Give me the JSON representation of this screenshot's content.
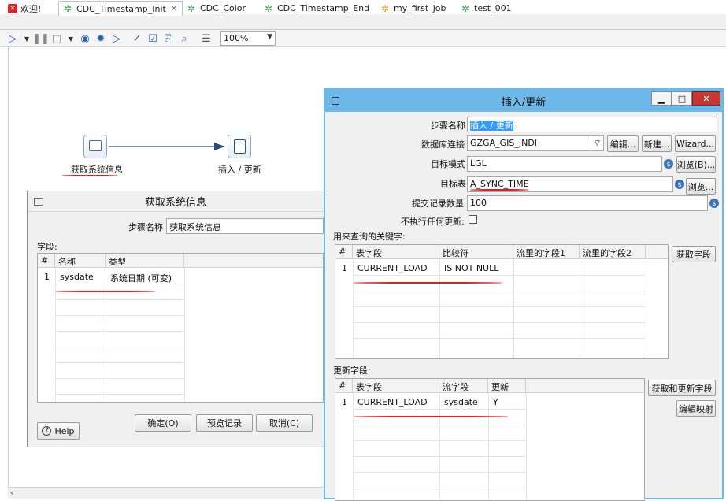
{
  "tabs": [
    {
      "label": "欢迎!",
      "icon": "welcome-icon",
      "active": false
    },
    {
      "label": "CDC_Timestamp_Init",
      "icon": "transformation-icon",
      "active": true
    },
    {
      "label": "CDC_Color",
      "icon": "transformation-icon",
      "active": false
    },
    {
      "label": "CDC_Timestamp_End",
      "icon": "transformation-icon",
      "active": false
    },
    {
      "label": "my_first_job",
      "icon": "job-icon",
      "active": false
    },
    {
      "label": "test_001",
      "icon": "transformation-icon",
      "active": false
    }
  ],
  "toolbar": {
    "zoom": "100%",
    "icons": [
      "run-icon",
      "run-dropdown-icon",
      "pause-icon",
      "stop-icon",
      "stop-dropdown-icon",
      "preview-icon",
      "debug-icon",
      "replay-icon",
      "verify-icon",
      "analyze-icon",
      "sql-icon",
      "explore-db-icon",
      "show-results-icon"
    ]
  },
  "canvas": {
    "step1_label": "获取系统信息",
    "step2_label": "插入 / 更新"
  },
  "sysinfo_dialog": {
    "title": "获取系统信息",
    "step_name_label": "步骤名称",
    "step_name_value": "获取系统信息",
    "fields_label": "字段:",
    "columns": [
      "#",
      "名称",
      "类型"
    ],
    "rows": [
      {
        "num": "1",
        "name": "sysdate",
        "type": "系统日期 (可变)"
      }
    ],
    "help_label": "Help",
    "ok_label": "确定(O)",
    "preview_label": "预览记录",
    "cancel_label": "取消(C)"
  },
  "insert_dialog": {
    "title": "插入/更新",
    "window_buttons": {
      "minimize": "▁",
      "maximize": "□",
      "close": "✕"
    },
    "step_name_label": "步骤名称",
    "step_name_value": "插入 / 更新",
    "connection_label": "数据库连接",
    "connection_value": "GZGA_GIS_JNDI",
    "edit_label": "编辑...",
    "new_label": "新建...",
    "wizard_label": "Wizard...",
    "schema_label": "目标模式",
    "schema_value": "LGL",
    "browse_schema_label": "浏览(B)...",
    "table_label": "目标表",
    "table_value": "A_SYNC_TIME",
    "browse_table_label": "浏览...",
    "commit_label": "提交记录数量",
    "commit_value": "100",
    "no_update_label": "不执行任何更新:",
    "keys_label": "用来查询的关键字:",
    "keys_columns": [
      "#",
      "表字段",
      "比较符",
      "流里的字段1",
      "流里的字段2"
    ],
    "keys_rows": [
      {
        "num": "1",
        "table_field": "CURRENT_LOAD",
        "comparator": "IS NOT NULL",
        "stream1": "",
        "stream2": ""
      }
    ],
    "get_fields_label": "获取字段",
    "update_label": "更新字段:",
    "update_columns": [
      "#",
      "表字段",
      "流字段",
      "更新"
    ],
    "update_rows": [
      {
        "num": "1",
        "table_field": "CURRENT_LOAD",
        "stream_field": "sysdate",
        "update": "Y"
      }
    ],
    "get_update_fields_label": "获取和更新字段",
    "edit_mapping_label": "编辑映射"
  },
  "colors": {
    "dialog_title_bg": "#6cb8e8",
    "annotation_red": "#e02020",
    "selection_blue": "#3399ff"
  }
}
